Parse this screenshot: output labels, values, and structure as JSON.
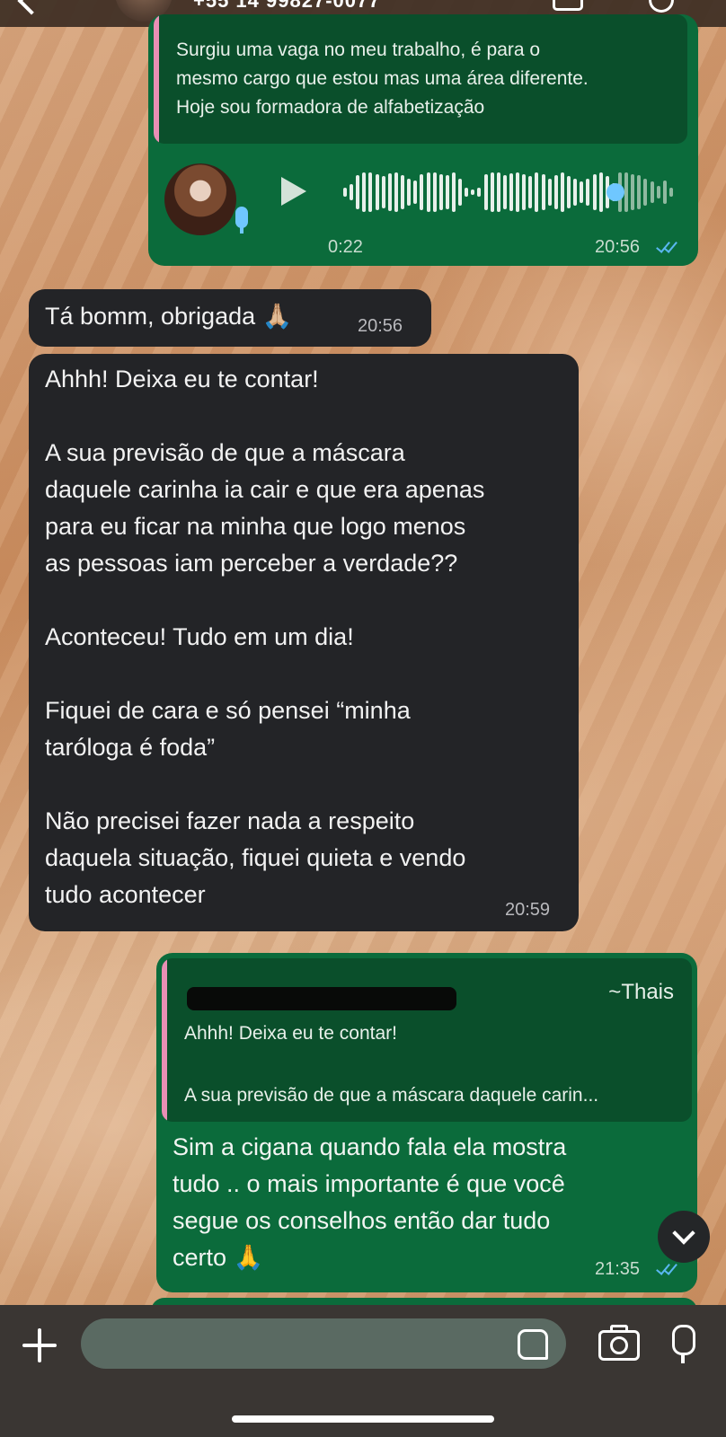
{
  "header": {
    "phone_partial": "+55 14 99827-0077",
    "back_icon": "chevron-left-icon",
    "video_icon": "video-call-icon",
    "call_icon": "phone-call-icon"
  },
  "messages": {
    "voice": {
      "quoted_text": "Surgiu uma vaga no meu trabalho, é para o\nmesmo cargo que estou mas uma área diferente.\nHoje sou formadora de alfabetização",
      "duration": "0:22",
      "time": "20:56",
      "progress_fraction": 0.82
    },
    "in1": {
      "text": "Tá bomm, obrigada 🙏🏼",
      "time": "20:56"
    },
    "in2": {
      "text": "Ahhh! Deixa eu te contar!\n\nA sua previsão de que a máscara\ndaquele carinha ia cair e que era apenas\npara eu ficar na minha que logo menos\nas pessoas iam perceber a verdade??\n\nAconteceu! Tudo em um dia!\n\nFiquei de cara e só pensei “minha\ntaróloga é foda”\n\nNão precisei fazer nada a respeito\ndaquela situação, fiquei quieta e vendo\ntudo acontecer",
      "time": "20:59"
    },
    "out2": {
      "quote_author": "~Thais",
      "quote_line1": "Ahhh! Deixa eu te contar!",
      "quote_line2": "A sua previsão de que a máscara daquele carin...",
      "text": "Sim a cigana quando fala ela mostra\ntudo .. o mais importante é que você\nsegue os conselhos então dar tudo\ncerto 🙏",
      "time": "21:35"
    }
  },
  "composer": {
    "placeholder": "",
    "icons": [
      "plus-icon",
      "sticker-icon",
      "camera-icon",
      "microphone-icon"
    ]
  },
  "colors": {
    "outgoing_bubble": "#0b6b3b",
    "incoming_bubble": "#232427",
    "quote_bar": "#e98fb5",
    "read_ticks": "#5ab7f0"
  }
}
